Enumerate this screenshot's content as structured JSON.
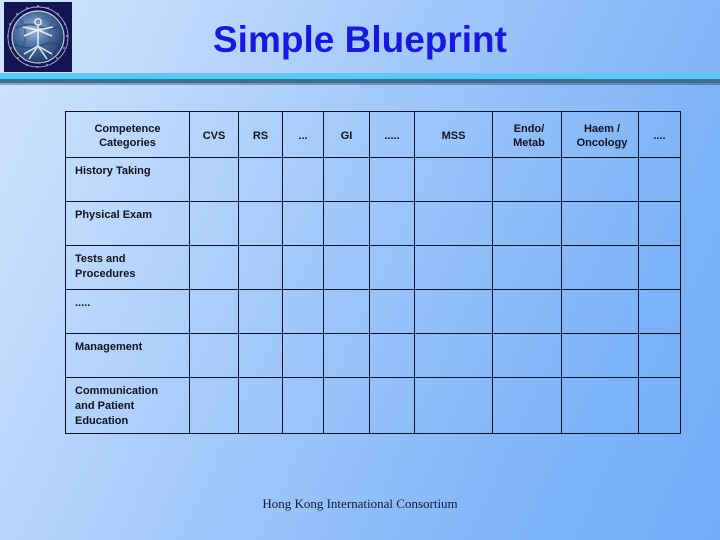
{
  "slide": {
    "title": "Simple Blueprint",
    "footer": "Hong Kong International Consortium",
    "logo_alt": "globe-vitruvian-man-logo",
    "accent_title_color": "#1a1ad6",
    "accent_rule_color": "#5bc8f5",
    "accent_rule_dark_color": "#3c6f93",
    "logo_background_color": "#141452",
    "background_light": "#cfe4fd",
    "background_dark": "#74acf7"
  },
  "table": {
    "columns": [
      {
        "label": "Competence\nCategories",
        "align": "center"
      },
      {
        "label": "CVS",
        "align": "center"
      },
      {
        "label": "RS",
        "align": "center"
      },
      {
        "label": "...",
        "align": "center"
      },
      {
        "label": "GI",
        "align": "center"
      },
      {
        "label": ".....",
        "align": "center"
      },
      {
        "label": "MSS",
        "align": "center"
      },
      {
        "label": "Endo/\nMetab",
        "align": "left"
      },
      {
        "label": "Haem /\nOncology",
        "align": "left"
      },
      {
        "label": "....",
        "align": "center"
      }
    ],
    "rows": [
      {
        "label": "History Taking",
        "cells": [
          "",
          "",
          "",
          "",
          "",
          "",
          "",
          "",
          ""
        ]
      },
      {
        "label": "Physical Exam",
        "cells": [
          "",
          "",
          "",
          "",
          "",
          "",
          "",
          "",
          ""
        ]
      },
      {
        "label": "Tests and\n      Procedures",
        "cells": [
          "",
          "",
          "",
          "",
          "",
          "",
          "",
          "",
          ""
        ]
      },
      {
        "label": ".....",
        "cells": [
          "",
          "",
          "",
          "",
          "",
          "",
          "",
          "",
          ""
        ]
      },
      {
        "label": "Management",
        "cells": [
          "",
          "",
          "",
          "",
          "",
          "",
          "",
          "",
          ""
        ]
      },
      {
        "label": "Communication\n      and Patient\n           Education",
        "cells": [
          "",
          "",
          "",
          "",
          "",
          "",
          "",
          "",
          ""
        ]
      }
    ]
  }
}
